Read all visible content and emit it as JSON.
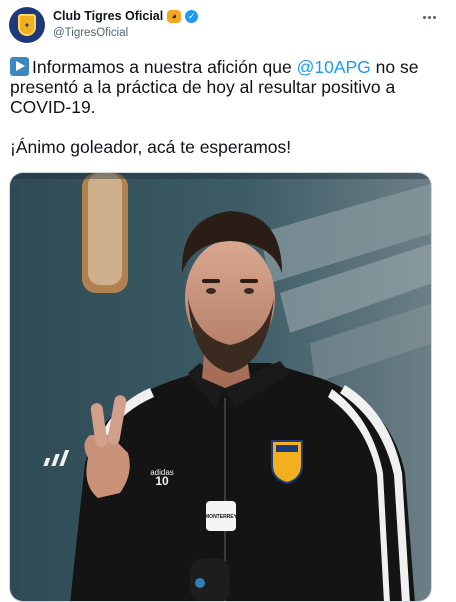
{
  "author": {
    "display_name": "Club Tigres Oficial",
    "handle": "@TigresOficial",
    "avatar_icon": "tigres-shield-logo",
    "verified": true,
    "name_emoji": "tiger-face-icon"
  },
  "tweet": {
    "leading_emoji": "play-button-icon",
    "line1_before": "Informamos a nuestra afición que ",
    "mention": "@10APG",
    "line1_after": " no se presentó a la práctica de hoy al resultar positivo a COVID-19.",
    "paragraph2": "¡Ánimo goleador, acá te esperamos!"
  },
  "media": {
    "description_icon": "player-photo",
    "jersey_number": "10",
    "brand": "adidas",
    "sponsor": "MONTERREY"
  },
  "colors": {
    "link": "#1d9bf0",
    "verified": "#1d9bf0",
    "text": "#0f1419",
    "secondary": "#536471"
  }
}
